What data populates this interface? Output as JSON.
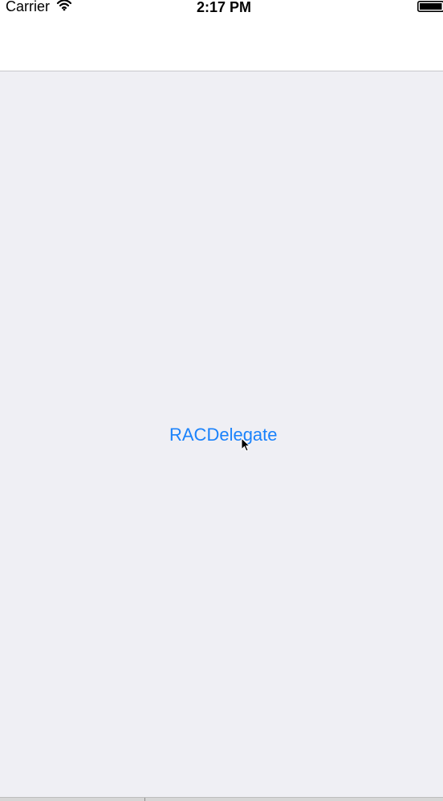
{
  "status_bar": {
    "carrier": "Carrier",
    "time": "2:17 PM",
    "wifi_icon": "wifi-icon",
    "battery_icon": "battery-icon"
  },
  "navigation": {
    "title": ""
  },
  "content": {
    "button_label": "RACDelegate",
    "button_color": "#1a82fb",
    "background_color": "#efeff4",
    "cursor_icon": "mouse-pointer-icon"
  }
}
